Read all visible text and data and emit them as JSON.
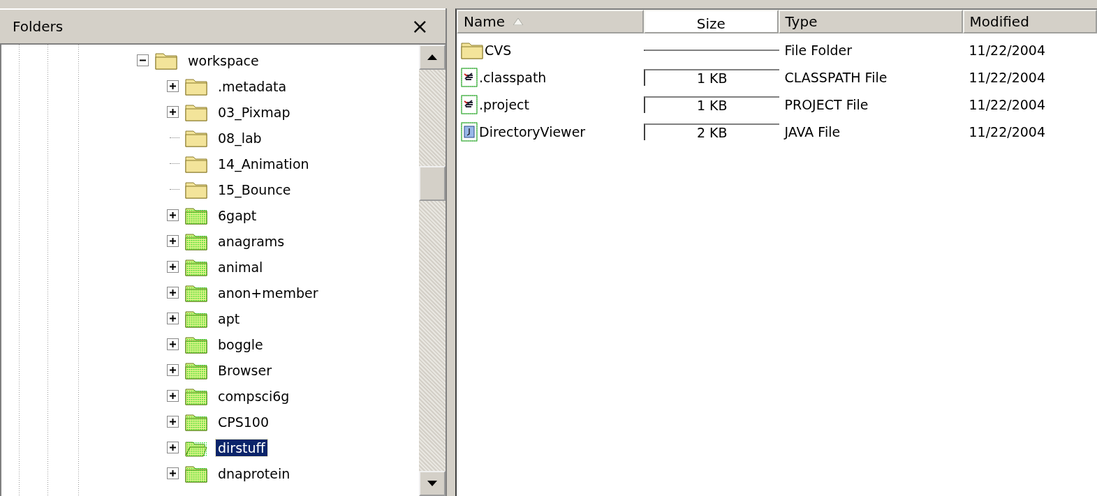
{
  "folders_pane": {
    "title": "Folders",
    "close": "×",
    "tree": [
      {
        "label": "workspace",
        "kind": "folder",
        "has_children": true,
        "expanded": true,
        "selected": false,
        "children": [
          {
            "label": ".metadata",
            "kind": "folder",
            "has_children": true,
            "expanded": false,
            "selected": false
          },
          {
            "label": "03_Pixmap",
            "kind": "folder",
            "has_children": true,
            "expanded": false,
            "selected": false
          },
          {
            "label": "08_lab",
            "kind": "folder",
            "has_children": false,
            "selected": false
          },
          {
            "label": "14_Animation",
            "kind": "folder",
            "has_children": false,
            "selected": false
          },
          {
            "label": "15_Bounce",
            "kind": "folder",
            "has_children": false,
            "selected": false
          },
          {
            "label": "6gapt",
            "kind": "project",
            "has_children": true,
            "expanded": false,
            "selected": false
          },
          {
            "label": "anagrams",
            "kind": "project",
            "has_children": true,
            "expanded": false,
            "selected": false
          },
          {
            "label": "animal",
            "kind": "project",
            "has_children": true,
            "expanded": false,
            "selected": false
          },
          {
            "label": "anon+member",
            "kind": "project",
            "has_children": true,
            "expanded": false,
            "selected": false
          },
          {
            "label": "apt",
            "kind": "project",
            "has_children": true,
            "expanded": false,
            "selected": false
          },
          {
            "label": "boggle",
            "kind": "project",
            "has_children": true,
            "expanded": false,
            "selected": false
          },
          {
            "label": "Browser",
            "kind": "project",
            "has_children": true,
            "expanded": false,
            "selected": false
          },
          {
            "label": "compsci6g",
            "kind": "project",
            "has_children": true,
            "expanded": false,
            "selected": false
          },
          {
            "label": "CPS100",
            "kind": "project",
            "has_children": true,
            "expanded": false,
            "selected": false
          },
          {
            "label": "dirstuff",
            "kind": "project",
            "has_children": true,
            "expanded": false,
            "selected": true
          },
          {
            "label": "dnaprotein",
            "kind": "project",
            "has_children": true,
            "expanded": false,
            "selected": false
          }
        ]
      }
    ]
  },
  "file_list": {
    "columns": [
      {
        "label": "Name",
        "sorted": true
      },
      {
        "label": "Size",
        "sorted": false
      },
      {
        "label": "Type",
        "sorted": false
      },
      {
        "label": "Modified",
        "sorted": false
      }
    ],
    "rows": [
      {
        "kind": "folder",
        "name": "CVS",
        "type": "File Folder",
        "modified": "11/22/2004"
      },
      {
        "kind": "config",
        "name": ".classpath",
        "size": "1 KB",
        "type": "CLASSPATH File",
        "modified": "11/22/2004"
      },
      {
        "kind": "config",
        "name": ".project",
        "size": "1 KB",
        "type": "PROJECT File",
        "modified": "11/22/2004"
      },
      {
        "kind": "java",
        "name": "DirectoryViewer",
        "size": "2 KB",
        "type": "JAVA File",
        "modified": "11/22/2004"
      }
    ]
  }
}
